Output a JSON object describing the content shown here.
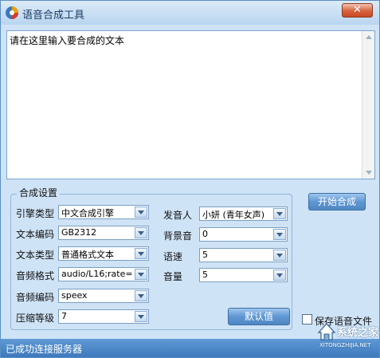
{
  "window": {
    "title": "语音合成工具",
    "close_glyph": "✕"
  },
  "editor": {
    "text": "请在这里输入要合成的文本"
  },
  "settings": {
    "group_title": "合成设置",
    "engine_label": "引擎类型",
    "engine_value": "中文合成引擎",
    "text_encoding_label": "文本编码",
    "text_encoding_value": "GB2312",
    "text_type_label": "文本类型",
    "text_type_value": "普通格式文本",
    "audio_format_label": "音频格式",
    "audio_format_value": "audio/L16;rate=",
    "audio_encoding_label": "音频编码",
    "audio_encoding_value": "speex",
    "compression_label": "压缩等级",
    "compression_value": "7",
    "speaker_label": "发音人",
    "speaker_value": "小妍 (青年女声)",
    "bg_sound_label": "背景音",
    "bg_sound_value": "0",
    "speed_label": "语速",
    "speed_value": "5",
    "volume_label": "音量",
    "volume_value": "5",
    "default_button": "默认值"
  },
  "actions": {
    "start_button": "开始合成",
    "save_audio_label": "保存语音文件",
    "save_audio_checked": false
  },
  "status": {
    "text": "已成功连接服务器"
  },
  "watermark": {
    "text": "系统之家",
    "subtext": "XITONGZHIJIA.NET"
  },
  "colors": {
    "window_bg": "#cfe3f6",
    "button_blue": "#5f97d2",
    "status_blue": "#3d79bb"
  }
}
